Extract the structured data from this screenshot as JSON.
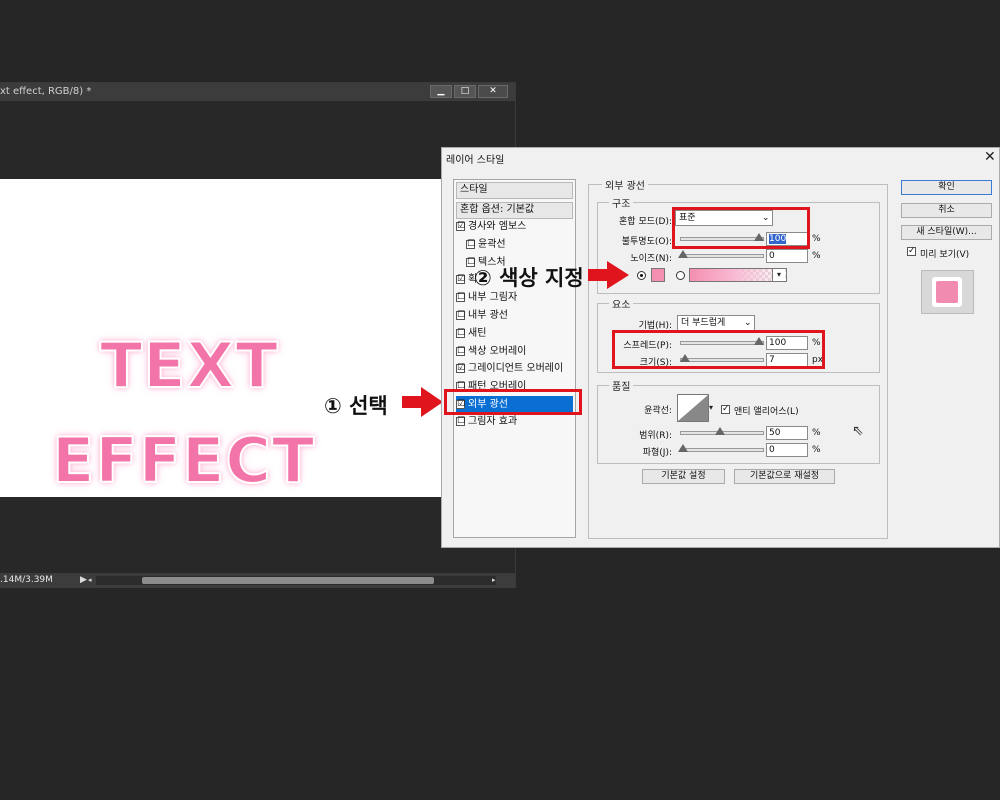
{
  "document_window": {
    "title": "xt effect, RGB/8) *",
    "buttons": {
      "minimize": "▁",
      "maximize": "□",
      "close": "✕"
    },
    "status": {
      "size": ".14M/3.39M",
      "arrow": "▶"
    }
  },
  "canvas_text": {
    "line1": "TEXT",
    "line2": "EFFECT"
  },
  "annotations": {
    "step1": "① 선택",
    "step2": "② 색상 지정"
  },
  "dialog": {
    "title": "레이어 스타일",
    "close": "✕",
    "styles_list": {
      "header": "스타일",
      "blend_options": "혼합 옵션: 기본값",
      "items": [
        {
          "label": "경사와 엠보스",
          "checked": "☑"
        },
        {
          "label": "윤곽선",
          "checked": "☐"
        },
        {
          "label": "텍스처",
          "checked": "☐"
        },
        {
          "label": "획",
          "checked": "☑"
        },
        {
          "label": "내부 그림자",
          "checked": "☐"
        },
        {
          "label": "내부 광선",
          "checked": "☐"
        },
        {
          "label": "새틴",
          "checked": "☐"
        },
        {
          "label": "색상 오버레이",
          "checked": "☐"
        },
        {
          "label": "그레이디언트 오버레이",
          "checked": "☑"
        },
        {
          "label": "패턴 오버레이",
          "checked": "☐"
        },
        {
          "label": "외부 광선",
          "checked": "☑"
        },
        {
          "label": "그림자 효과",
          "checked": "☐"
        }
      ]
    },
    "outer_glow": {
      "title": "외부 광선",
      "structure": {
        "title": "구조",
        "blend_mode_label": "혼합 모드(D):",
        "blend_mode_value": "표준",
        "opacity_label": "불투명도(O):",
        "opacity_value": "100",
        "opacity_unit": "%",
        "noise_label": "노이즈(N):",
        "noise_value": "0",
        "noise_unit": "%",
        "color": "#f48fb1"
      },
      "elements": {
        "title": "요소",
        "technique_label": "기법(H):",
        "technique_value": "더 부드럽게",
        "spread_label": "스프레드(P):",
        "spread_value": "100",
        "spread_unit": "%",
        "size_label": "크기(S):",
        "size_value": "7",
        "size_unit": "px"
      },
      "quality": {
        "title": "품질",
        "contour_label": "윤곽선:",
        "anti_alias_label": "앤티 앨리어스(L)",
        "range_label": "범위(R):",
        "range_value": "50",
        "range_unit": "%",
        "jitter_label": "파형(J):",
        "jitter_value": "0",
        "jitter_unit": "%"
      },
      "make_default": "기본값 설정",
      "reset_default": "기본값으로 재설정"
    },
    "buttons": {
      "ok": "확인",
      "cancel": "취소",
      "new_style": "새 스타일(W)...",
      "preview_label": "미리 보기(V)"
    }
  },
  "colors": {
    "accent_red": "#e0141d",
    "glow_pink": "#f48fb1",
    "selection_blue": "#0a6fd3"
  }
}
